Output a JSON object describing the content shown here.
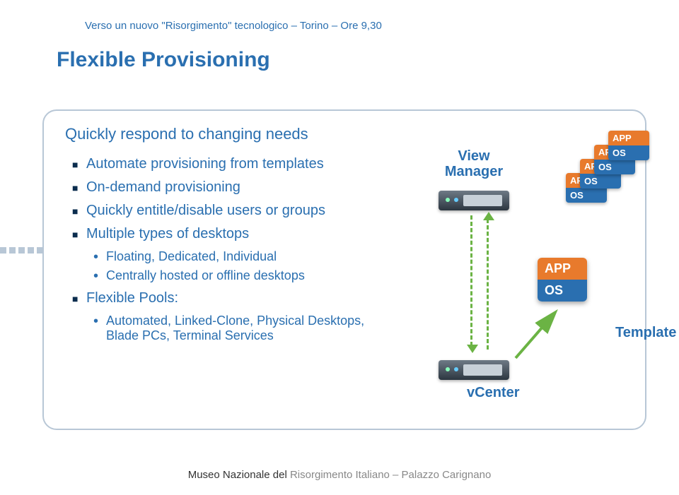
{
  "header": {
    "breadcrumb": "Verso un nuovo \"Risorgimento\" tecnologico – Torino – Ore 9,30"
  },
  "title": "Flexible Provisioning",
  "lead": "Quickly respond to changing needs",
  "bullets": {
    "b1": "Automate provisioning from templates",
    "b2": "On-demand provisioning",
    "b3": "Quickly entitle/disable users or groups",
    "b4": "Multiple types of desktops",
    "b4_sub1": "Floating, Dedicated, Individual",
    "b4_sub2": "Centrally hosted or offline desktops",
    "b5": "Flexible Pools:",
    "b5_sub1": "Automated, Linked-Clone, Physical Desktops, Blade PCs, Terminal Services"
  },
  "diagram": {
    "view_manager": "View Manager",
    "vcenter": "vCenter",
    "template": "Template",
    "tile_app": "APP",
    "tile_os": "OS"
  },
  "footer": {
    "left": "Museo Nazionale del ",
    "right": "Risorgimento Italiano – Palazzo Carignano"
  }
}
